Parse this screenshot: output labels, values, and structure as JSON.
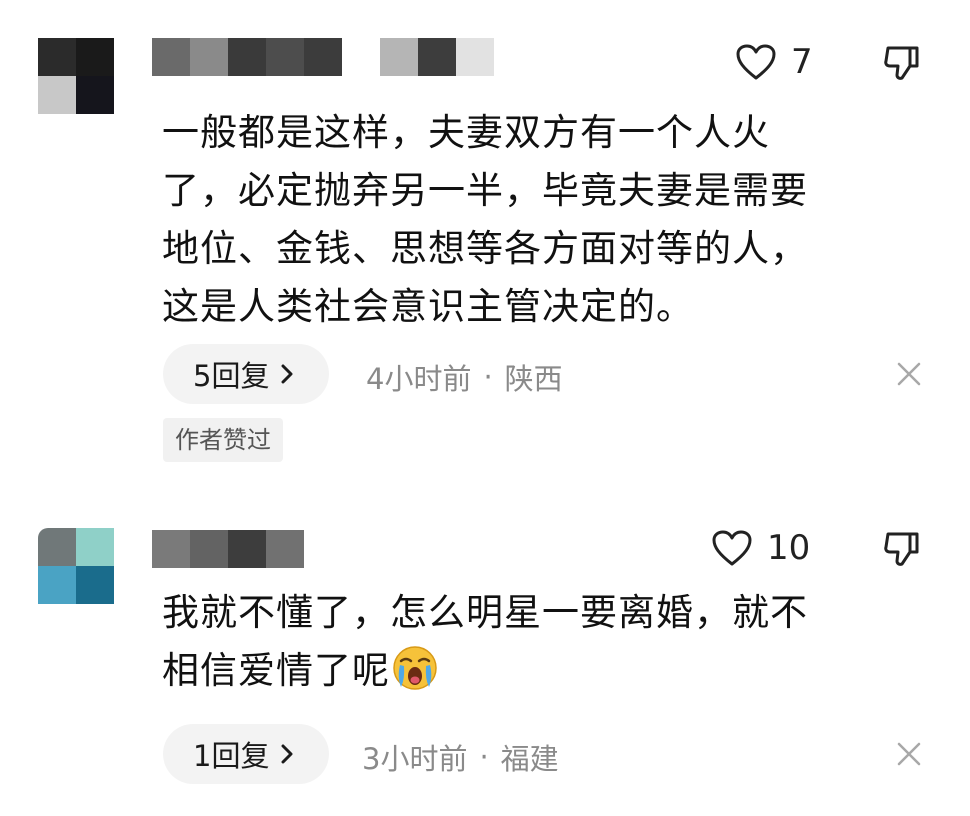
{
  "comments": [
    {
      "like_count": "7",
      "body_lines": [
        "一般都是这样，夫妻双方有一个人火",
        "了，必定抛弃另一半，毕竟夫妻是需要",
        "地位、金钱、思想等各方面对等的人，",
        "这是人类社会意识主管决定的。"
      ],
      "reply_label": "5回复",
      "time": "4小时前",
      "location": "陕西",
      "author_badge": "作者赞过",
      "avatar_colors": [
        "#2b2b2b",
        "#1a1a1a",
        "#c8c8c8",
        "#15151c"
      ],
      "username_colors": [
        "#6a6a6a",
        "#8a8a8a",
        "#3a3a3a",
        "#4d4d4d",
        "#3c3c3c",
        "#b5b5b5",
        "#3d3d3d",
        "#e2e2e2"
      ]
    },
    {
      "like_count": "10",
      "body_lines": [
        "我就不懂了，怎么明星一要离婚，就不",
        "相信爱情了呢"
      ],
      "emoji_icon": "crying-face-emoji",
      "reply_label": "1回复",
      "time": "3小时前",
      "location": "福建",
      "avatar_colors": [
        "#707879",
        "#8fd0c8",
        "#4aa3c4",
        "#1a6c8c"
      ],
      "username_colors": [
        "#7a7a7a",
        "#636363",
        "#3d3d3d",
        "#717171"
      ]
    }
  ],
  "icons": {
    "like": "heart-outline-icon",
    "dislike": "thumbs-down-outline-icon",
    "reply_chevron": "chevron-right-icon",
    "close": "close-icon"
  },
  "meta_separator": "·"
}
